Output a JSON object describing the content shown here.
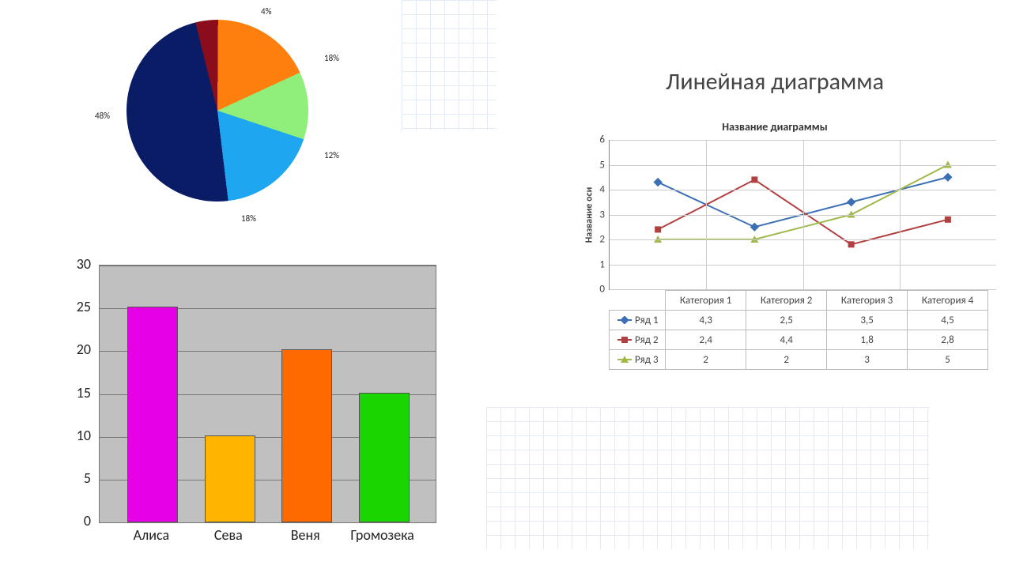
{
  "chart_data": [
    {
      "type": "pie",
      "title": "",
      "slices": [
        {
          "label": "4%",
          "value": 4,
          "color": "#8B0D1B"
        },
        {
          "label": "18%",
          "value": 18,
          "color": "#FF7F0E"
        },
        {
          "label": "12%",
          "value": 12,
          "color": "#90EE7B"
        },
        {
          "label": "18%",
          "value": 18,
          "color": "#1FA6F0"
        },
        {
          "label": "48%",
          "value": 48,
          "color": "#0A1C66"
        }
      ]
    },
    {
      "type": "bar",
      "categories": [
        "Алиса",
        "Сева",
        "Веня",
        "Громозека"
      ],
      "values": [
        25,
        10,
        20,
        15
      ],
      "colors": [
        "#E600E6",
        "#FFB400",
        "#FF6A00",
        "#1AD600"
      ],
      "ylabel": "",
      "xlabel": "",
      "ylim": [
        0,
        30
      ],
      "yticks": [
        0,
        5,
        10,
        15,
        20,
        25,
        30
      ]
    },
    {
      "type": "line",
      "page_heading": "Линейная диаграмма",
      "title": "Название диаграммы",
      "ylabel": "Название оси",
      "xlabel": "",
      "ylim": [
        0,
        6
      ],
      "yticks": [
        0,
        1,
        2,
        3,
        4,
        5,
        6
      ],
      "categories": [
        "Категория 1",
        "Категория 2",
        "Категория 3",
        "Категория 4"
      ],
      "series": [
        {
          "name": "Ряд 1",
          "color": "#3C6FB3",
          "marker": "diamond",
          "values": [
            4.3,
            2.5,
            3.5,
            4.5
          ],
          "display": [
            "4,3",
            "2,5",
            "3,5",
            "4,5"
          ]
        },
        {
          "name": "Ряд 2",
          "color": "#B34040",
          "marker": "square",
          "values": [
            2.4,
            4.4,
            1.8,
            2.8
          ],
          "display": [
            "2,4",
            "4,4",
            "1,8",
            "2,8"
          ]
        },
        {
          "name": "Ряд 3",
          "color": "#9FB94A",
          "marker": "triangle",
          "values": [
            2,
            2,
            3,
            5
          ],
          "display": [
            "2",
            "2",
            "3",
            "5"
          ]
        }
      ]
    }
  ]
}
